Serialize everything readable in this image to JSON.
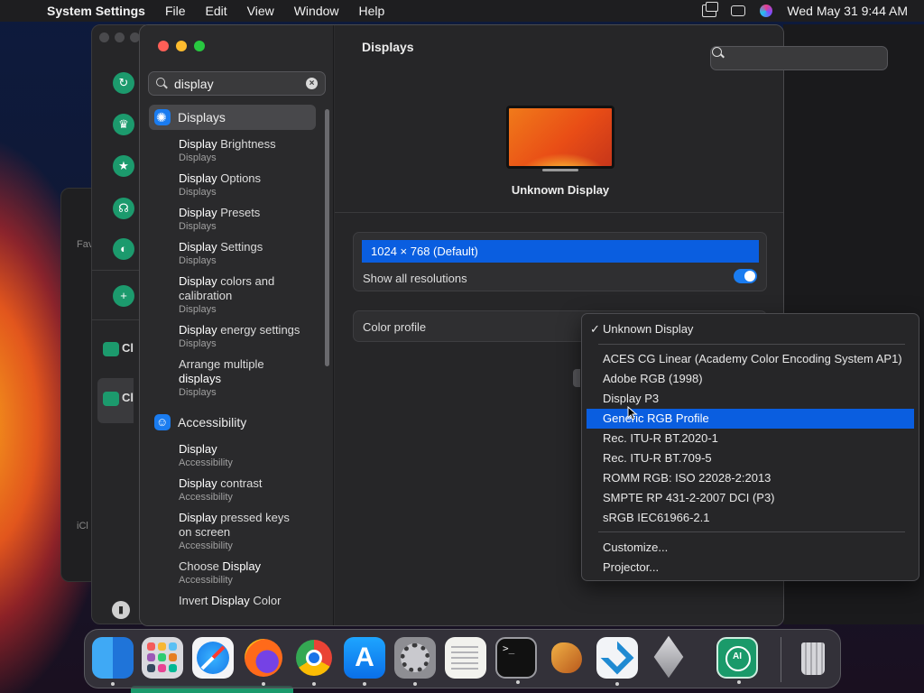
{
  "menubar": {
    "app_name": "System Settings",
    "items": [
      "File",
      "Edit",
      "View",
      "Window",
      "Help"
    ],
    "datetime": "Wed May 31  9:44 AM"
  },
  "background_app": {
    "chat_label_1": "Cl",
    "chat_label_2": "Cl",
    "side_text_1": "Fav",
    "side_text_2": "iCl"
  },
  "sidebar": {
    "search": {
      "value": "display",
      "placeholder": "Search"
    },
    "categories": [
      {
        "label": "Displays",
        "selected": true,
        "items": [
          {
            "title_bold": "Display",
            "title_rest": " Brightness",
            "sub": "Displays"
          },
          {
            "title_bold": "Display",
            "title_rest": " Options",
            "sub": "Displays"
          },
          {
            "title_bold": "Display",
            "title_rest": " Presets",
            "sub": "Displays"
          },
          {
            "title_bold": "Display",
            "title_rest": " Settings",
            "sub": "Displays"
          },
          {
            "title_bold": "Display",
            "title_rest": " colors and calibration",
            "sub": "Displays"
          },
          {
            "title_bold": "Display",
            "title_rest": " energy settings",
            "sub": "Displays"
          },
          {
            "title_pre": "Arrange multiple ",
            "title_bold": "displays",
            "title_rest": "",
            "sub": "Displays"
          }
        ]
      },
      {
        "label": "Accessibility",
        "selected": false,
        "items": [
          {
            "title_bold": "Display",
            "title_rest": "",
            "sub": "Accessibility"
          },
          {
            "title_bold": "Display",
            "title_rest": " contrast",
            "sub": "Accessibility"
          },
          {
            "title_bold": "Display",
            "title_rest": " pressed keys on screen",
            "sub": "Accessibility"
          },
          {
            "title_pre": "Choose ",
            "title_bold": "Display",
            "title_rest": "",
            "sub": "Accessibility"
          },
          {
            "title_pre": "Invert ",
            "title_bold": "Display",
            "title_rest": " Color",
            "sub": ""
          }
        ]
      }
    ]
  },
  "content": {
    "header": "Displays",
    "monitor_name": "Unknown Display",
    "resolution_selected": "1024 × 768 (Default)",
    "show_all_label": "Show all resolutions",
    "show_all_enabled": true,
    "color_profile_label": "Color profile"
  },
  "dropdown": {
    "checked": "Unknown Display",
    "group1": [
      "ACES CG Linear (Academy Color Encoding System AP1)",
      "Adobe RGB (1998)",
      "Display P3",
      "Generic RGB Profile",
      "Rec. ITU-R BT.2020-1",
      "Rec. ITU-R BT.709-5",
      "ROMM RGB: ISO 22028-2:2013",
      "SMPTE RP 431-2-2007 DCI (P3)",
      "sRGB IEC61966-2.1"
    ],
    "highlighted_index": 3,
    "group2": [
      "Customize...",
      "Projector..."
    ]
  },
  "dock": {
    "apps": [
      "finder-icon",
      "launchpad-icon",
      "safari-icon",
      "firefox-icon",
      "chrome-icon",
      "app-store-icon",
      "system-settings-icon",
      "textedit-icon",
      "terminal-icon",
      "garageband-icon",
      "vscode-icon",
      "installer-icon",
      "ai-atom-app-icon",
      "trash-icon"
    ],
    "terminal_glyph": ">_",
    "appstore_glyph": "A",
    "atom_label": "AI"
  },
  "colors": {
    "accent_blue": "#0a5ee0",
    "toggle_blue": "#1a7cf0",
    "close": "#fe5f57",
    "minimize": "#febc2e",
    "zoom": "#28c840"
  }
}
